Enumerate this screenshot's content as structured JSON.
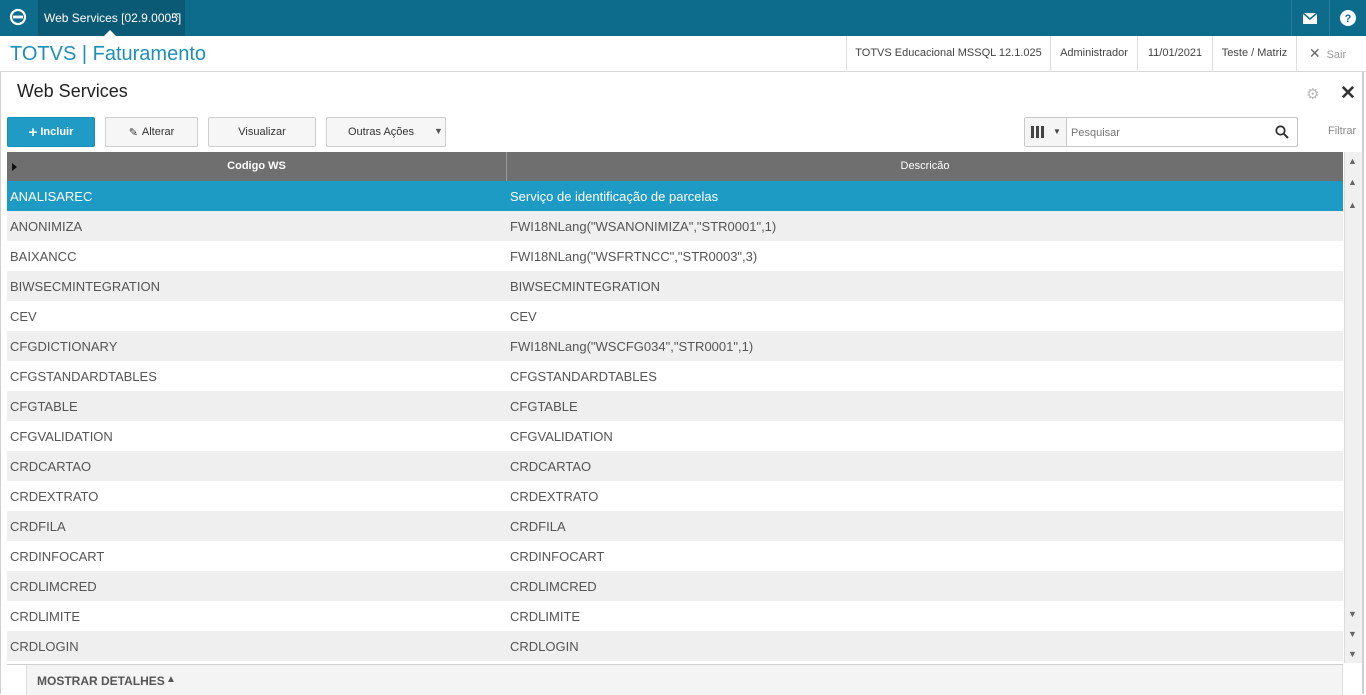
{
  "window": {
    "tab_title": "Web Services [02.9.0005]",
    "tab_close": "×"
  },
  "colors": {
    "topbar": "#0d6c8c",
    "accent": "#1f9bc6",
    "selected_row": "#1e9bc4",
    "title": "#1f8fb8"
  },
  "header": {
    "app_title": "TOTVS | Faturamento",
    "environment": "TOTVS Educacional MSSQL 12.1.025",
    "user": "Administrador",
    "date": "11/01/2021",
    "company": "Teste / Matriz",
    "exit_label": "Sair"
  },
  "page": {
    "title": "Web Services"
  },
  "toolbar": {
    "include_label": "Incluir",
    "alter_label": "Alterar",
    "view_label": "Visualizar",
    "other_label": "Outras Ações",
    "search_placeholder": "Pesquisar",
    "filter_label": "Filtrar"
  },
  "table": {
    "columns": [
      "Codigo WS",
      "Descricão"
    ],
    "rows": [
      [
        "ANALISAREC",
        "Serviço de identificação de parcelas"
      ],
      [
        "ANONIMIZA",
        "FWI18NLang(\"WSANONIMIZA\",\"STR0001\",1)"
      ],
      [
        "BAIXANCC",
        "FWI18NLang(\"WSFRTNCC\",\"STR0003\",3)"
      ],
      [
        "BIWSECMINTEGRATION",
        "BIWSECMINTEGRATION"
      ],
      [
        "CEV",
        "CEV"
      ],
      [
        "CFGDICTIONARY",
        "FWI18NLang(\"WSCFG034\",\"STR0001\",1)"
      ],
      [
        "CFGSTANDARDTABLES",
        "CFGSTANDARDTABLES"
      ],
      [
        "CFGTABLE",
        "CFGTABLE"
      ],
      [
        "CFGVALIDATION",
        "CFGVALIDATION"
      ],
      [
        "CRDCARTAO",
        "CRDCARTAO"
      ],
      [
        "CRDEXTRATO",
        "CRDEXTRATO"
      ],
      [
        "CRDFILA",
        "CRDFILA"
      ],
      [
        "CRDINFOCART",
        "CRDINFOCART"
      ],
      [
        "CRDLIMCRED",
        "CRDLIMCRED"
      ],
      [
        "CRDLIMITE",
        "CRDLIMITE"
      ],
      [
        "CRDLOGIN",
        "CRDLOGIN"
      ]
    ]
  },
  "details": {
    "label": "MOSTRAR DETALHES"
  },
  "icons": {
    "logo": "totvs-logo-icon",
    "mail": "mail-icon",
    "help": "help-icon",
    "gear": "gear-icon",
    "close": "close-icon",
    "search": "search-icon",
    "columns": "columns-icon"
  }
}
